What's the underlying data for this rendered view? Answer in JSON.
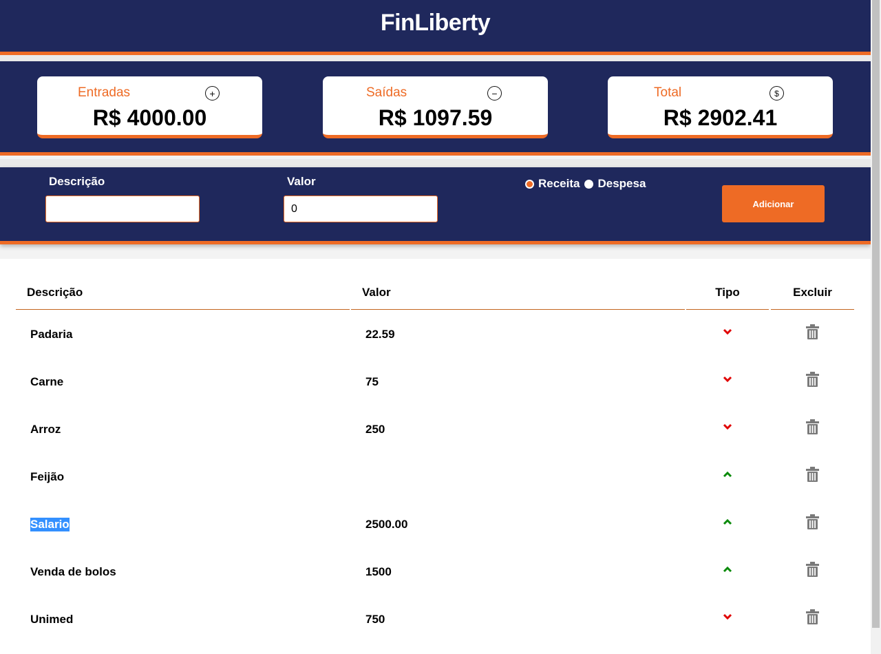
{
  "app": {
    "title": "FinLiberty"
  },
  "summary": {
    "income": {
      "label": "Entradas",
      "icon": "plus-circle-icon",
      "value": "R$ 4000.00"
    },
    "expense": {
      "label": "Saídas",
      "icon": "minus-circle-icon",
      "value": "R$ 1097.59"
    },
    "total": {
      "label": "Total",
      "icon": "dollar-circle-icon",
      "value": "R$ 2902.41"
    }
  },
  "form": {
    "description_label": "Descrição",
    "description_value": "",
    "value_label": "Valor",
    "value_value": "0",
    "radio_income_label": "Receita",
    "radio_expense_label": "Despesa",
    "selected_type": "Receita",
    "add_button": "Adicionar"
  },
  "table": {
    "headers": [
      "Descrição",
      "Valor",
      "Tipo",
      "Excluir"
    ],
    "rows": [
      {
        "description": "Padaria",
        "value": "22.59",
        "type": "expense"
      },
      {
        "description": "Carne",
        "value": "75",
        "type": "expense"
      },
      {
        "description": "Arroz",
        "value": "250",
        "type": "expense"
      },
      {
        "description": "Feijão",
        "value": "",
        "type": "income"
      },
      {
        "description": "Salario",
        "value": "2500.00",
        "type": "income"
      },
      {
        "description": "Venda de bolos",
        "value": "1500",
        "type": "income"
      },
      {
        "description": "Unimed",
        "value": "750",
        "type": "expense"
      }
    ]
  },
  "colors": {
    "navy": "#1f285c",
    "accent": "#ee6b25",
    "income_arrow": "#0a8a0a",
    "expense_arrow": "#e00000",
    "trash": "#7a7a7a"
  }
}
